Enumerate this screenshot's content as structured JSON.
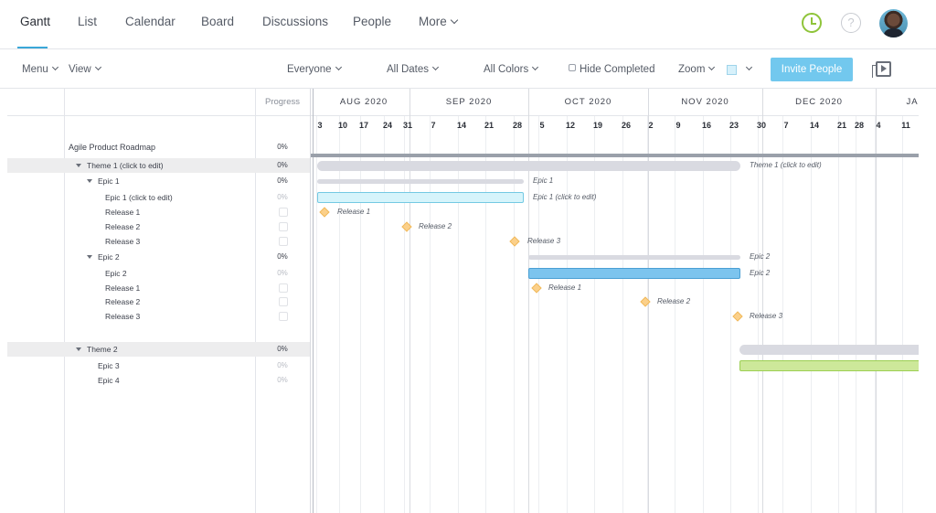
{
  "nav": {
    "tabs": [
      "Gantt",
      "List",
      "Calendar",
      "Board",
      "Discussions",
      "People",
      "More"
    ],
    "active_tab": "Gantt",
    "help_glyph": "?",
    "icons": [
      "clock-icon",
      "help-icon",
      "avatar"
    ]
  },
  "toolbar": {
    "menu_label": "Menu",
    "view_label": "View",
    "everyone_label": "Everyone",
    "dates_label": "All Dates",
    "colors_label": "All Colors",
    "hide_completed_label": "Hide Completed",
    "zoom_label": "Zoom",
    "invite_label": "Invite People",
    "accent_color": "#72c8ee"
  },
  "grid": {
    "progress_header": "Progress",
    "rows": [
      {
        "label": "Agile Product Roadmap",
        "progress": "0%"
      },
      {
        "label": "Theme 1 (click to edit)",
        "progress": "0%"
      },
      {
        "label": "Epic 1",
        "progress": "0%"
      },
      {
        "label": "Epic 1 (click to edit)",
        "progress": "0%"
      },
      {
        "label": "Release 1",
        "progress": ""
      },
      {
        "label": "Release 2",
        "progress": ""
      },
      {
        "label": "Release 3",
        "progress": ""
      },
      {
        "label": "Epic 2",
        "progress": "0%"
      },
      {
        "label": "Epic 2",
        "progress": "0%"
      },
      {
        "label": "Release 1",
        "progress": ""
      },
      {
        "label": "Release 2",
        "progress": ""
      },
      {
        "label": "Release 3",
        "progress": ""
      },
      {
        "label": "Theme 2",
        "progress": "0%"
      },
      {
        "label": "Epic 3",
        "progress": "0%"
      },
      {
        "label": "Epic 4",
        "progress": "0%"
      }
    ]
  },
  "timeline": {
    "months": [
      "AUG 2020",
      "SEP 2020",
      "OCT 2020",
      "NOV 2020",
      "DEC 2020",
      "JA"
    ],
    "days": [
      "3",
      "10",
      "17",
      "24",
      "31",
      "7",
      "14",
      "21",
      "28",
      "5",
      "12",
      "19",
      "26",
      "2",
      "9",
      "16",
      "23",
      "30",
      "7",
      "14",
      "21",
      "28",
      "4",
      "11"
    ],
    "bar_labels": {
      "theme1": "Theme 1 (click to edit)",
      "epic1_summary": "Epic 1",
      "epic1_task": "Epic 1 (click to edit)",
      "epic1_release1": "Release 1",
      "epic1_release2": "Release 2",
      "epic1_release3": "Release 3",
      "epic2_summary": "Epic 2",
      "epic2_task": "Epic 2",
      "epic2_release1": "Release 1",
      "epic2_release2": "Release 2",
      "epic2_release3": "Release 3"
    },
    "colors": {
      "summary": "#d9dae1",
      "epic1_task": "#d6f4fb",
      "epic2_task": "#7cc4ee",
      "epic3_task": "#cde89a",
      "milestone": "#fbd08a"
    }
  }
}
